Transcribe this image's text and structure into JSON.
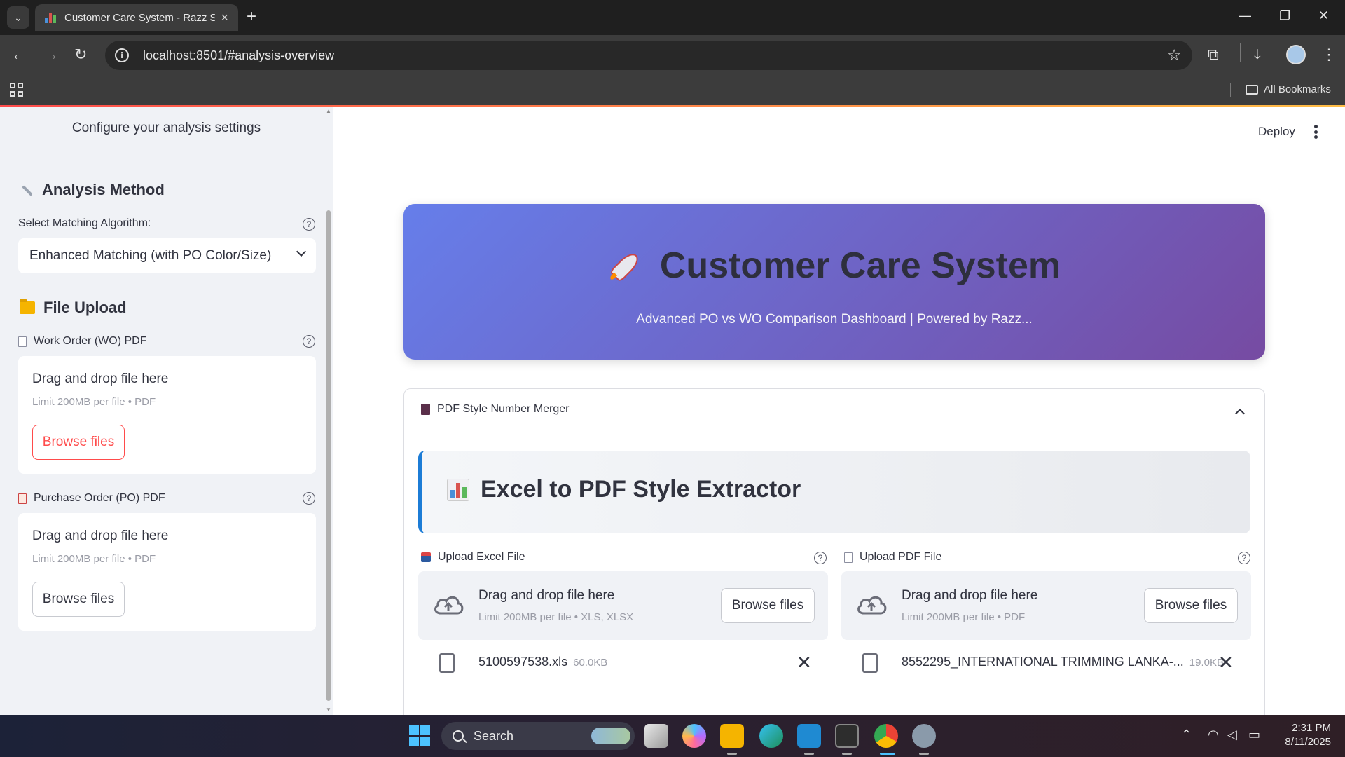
{
  "browser": {
    "tab_title": "Customer Care System - Razz S",
    "tab_close": "×",
    "new_tab": "+",
    "url": "localhost:8501/#analysis-overview",
    "all_bookmarks": "All Bookmarks"
  },
  "sidebar": {
    "caption": "Configure your analysis settings",
    "analysis_heading": "Analysis Method",
    "algorithm_label": "Select Matching Algorithm:",
    "algorithm_value": "Enhanced Matching (with PO Color/Size)",
    "upload_heading": "File Upload",
    "wo_label": "Work Order (WO) PDF",
    "po_label": "Purchase Order (PO) PDF",
    "drop_text": "Drag and drop file here",
    "drop_limit": "Limit 200MB per file • PDF",
    "browse_label": "Browse files",
    "help_glyph": "?"
  },
  "header": {
    "deploy_label": "Deploy"
  },
  "hero": {
    "title": "Customer Care System",
    "subtitle": "Advanced PO vs WO Comparison Dashboard | Powered by Razz..."
  },
  "expander": {
    "label": "PDF Style Number Merger",
    "extractor_title": "Excel to PDF Style Extractor",
    "excel": {
      "label": "Upload Excel File",
      "drop_text": "Drag and drop file here",
      "drop_limit": "Limit 200MB per file • XLS, XLSX",
      "browse_label": "Browse files",
      "file_name": "5100597538.xls",
      "file_size": "60.0KB"
    },
    "pdf": {
      "label": "Upload PDF File",
      "drop_text": "Drag and drop file here",
      "drop_limit": "Limit 200MB per file • PDF",
      "browse_label": "Browse files",
      "file_name": "8552295_INTERNATIONAL TRIMMING LANKA-...",
      "file_size": "19.0KB"
    },
    "remove_glyph": "✕"
  },
  "taskbar": {
    "search_placeholder": "Search",
    "time": "2:31 PM",
    "date": "8/11/2025"
  },
  "colors": {
    "primary": "#ff4b4b",
    "hero_gradient_start": "#667eea",
    "hero_gradient_end": "#764ba2",
    "sidebar_bg": "#f0f2f6",
    "extractor_accent": "#1c7cd6"
  }
}
